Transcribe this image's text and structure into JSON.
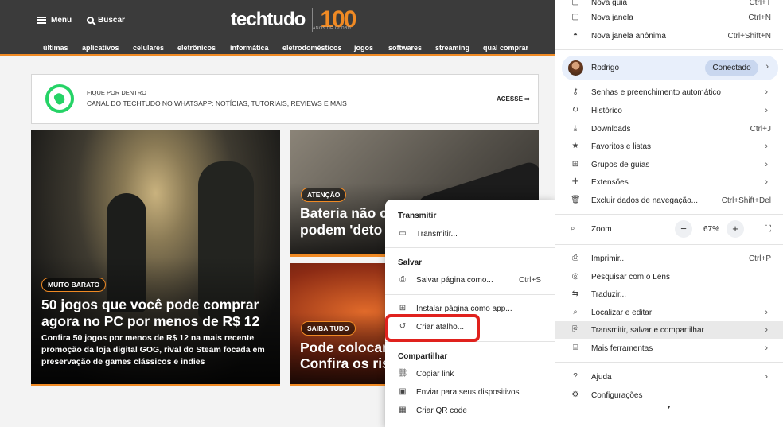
{
  "site": {
    "menu_label": "Menu",
    "search_label": "Buscar",
    "logo_word": "techtudo",
    "logo_100": "100",
    "logo_sub": "ANOS DE GLOBO",
    "nav": [
      "últimas",
      "aplicativos",
      "celulares",
      "eletrônicos",
      "informática",
      "eletrodomésticos",
      "jogos",
      "softwares",
      "streaming",
      "qual comprar"
    ],
    "accent_color": "#f08a24"
  },
  "whatsapp": {
    "title": "FIQUE POR DENTRO",
    "subtitle": "CANAL DO TECHTUDO NO WHATSAPP: NOTÍCIAS, TUTORIAIS, REVIEWS E MAIS",
    "cta": "ACESSE ➡",
    "icon": "whatsapp-icon"
  },
  "cards": {
    "big": {
      "badge": "MUITO BARATO",
      "title": "50 jogos que você pode comprar agora no PC por menos de R$ 12",
      "desc": "Confira 50 jogos por menos de R$ 12 na mais recente promoção da loja digital GOG, rival do Steam focada em preservação de games clássicos e indies"
    },
    "top_right": {
      "badge": "ATENÇÃO",
      "title_line1": "Bateria não c",
      "title_line2": "podem 'deto"
    },
    "bottom_right": {
      "badge": "SAIBA TUDO",
      "title_line1": "Pode colocar",
      "title_line2": "Confira os ris"
    }
  },
  "submenu": {
    "sections": {
      "transmit": "Transmitir",
      "save": "Salvar",
      "share": "Compartilhar"
    },
    "items": {
      "cast": {
        "label": "Transmitir...",
        "icon": "cast-icon"
      },
      "save_page": {
        "label": "Salvar página como...",
        "shortcut": "Ctrl+S",
        "icon": "save-page-icon"
      },
      "install": {
        "label": "Instalar página como app...",
        "icon": "install-app-icon"
      },
      "shortcut": {
        "label": "Criar atalho...",
        "icon": "shortcut-icon"
      },
      "copy_link": {
        "label": "Copiar link",
        "icon": "link-icon"
      },
      "send_devices": {
        "label": "Enviar para seus dispositivos",
        "icon": "devices-icon"
      },
      "qr": {
        "label": "Criar QR code",
        "icon": "qr-code-icon"
      }
    },
    "highlight_color": "#e0211d"
  },
  "chrome_menu": {
    "new_tab": {
      "label": "Nova guia",
      "shortcut": "Ctrl+T"
    },
    "new_window": {
      "label": "Nova janela",
      "shortcut": "Ctrl+N"
    },
    "incognito": {
      "label": "Nova janela anônima",
      "shortcut": "Ctrl+Shift+N"
    },
    "profile": {
      "name": "Rodrigo",
      "status": "Conectado"
    },
    "passwords": {
      "label": "Senhas e preenchimento automático"
    },
    "history": {
      "label": "Histórico"
    },
    "downloads": {
      "label": "Downloads",
      "shortcut": "Ctrl+J"
    },
    "bookmarks": {
      "label": "Favoritos e listas"
    },
    "tab_groups": {
      "label": "Grupos de guias"
    },
    "extensions": {
      "label": "Extensões"
    },
    "clear_data": {
      "label": "Excluir dados de navegação...",
      "shortcut": "Ctrl+Shift+Del"
    },
    "zoom": {
      "label": "Zoom",
      "value": "67%",
      "minus": "−",
      "plus": "+"
    },
    "print": {
      "label": "Imprimir...",
      "shortcut": "Ctrl+P"
    },
    "lens": {
      "label": "Pesquisar com o Lens"
    },
    "translate": {
      "label": "Traduzir..."
    },
    "find": {
      "label": "Localizar e editar"
    },
    "cast_save_share": {
      "label": "Transmitir, salvar e compartilhar"
    },
    "more_tools": {
      "label": "Mais ferramentas"
    },
    "help": {
      "label": "Ajuda"
    },
    "settings": {
      "label": "Configurações"
    }
  }
}
